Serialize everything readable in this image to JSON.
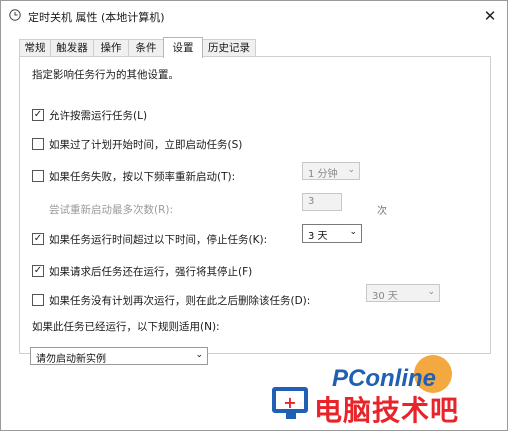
{
  "window": {
    "title": "定时关机 属性 (本地计算机)"
  },
  "tabs": [
    {
      "label": "常规"
    },
    {
      "label": "触发器"
    },
    {
      "label": "操作"
    },
    {
      "label": "条件"
    },
    {
      "label": "设置"
    },
    {
      "label": "历史记录"
    }
  ],
  "settings": {
    "description": "指定影响任务行为的其他设置。",
    "allow_on_demand": {
      "label": "允许按需运行任务(L)",
      "checked": true
    },
    "start_if_missed": {
      "label": "如果过了计划开始时间，立即启动任务(S)",
      "checked": false
    },
    "restart_on_fail": {
      "label": "如果任务失败，按以下频率重新启动(T):",
      "checked": false,
      "interval": "1 分钟"
    },
    "retry_count": {
      "label": "尝试重新启动最多次数(R):",
      "value": "3",
      "unit": "次"
    },
    "stop_if_longer": {
      "label": "如果任务运行时间超过以下时间，停止任务(K):",
      "checked": true,
      "value": "3 天"
    },
    "force_stop": {
      "label": "如果请求后任务还在运行，强行将其停止(F)",
      "checked": true
    },
    "delete_if_not_scheduled": {
      "label": "如果任务没有计划再次运行，则在此之后删除该任务(D):",
      "checked": false,
      "value": "30 天"
    },
    "rule_label": "如果此任务已经运行，以下规则适用(N):",
    "rule_value": "请勿启动新实例"
  },
  "watermark": {
    "brand": "PConline",
    "text": "电脑技术吧"
  }
}
